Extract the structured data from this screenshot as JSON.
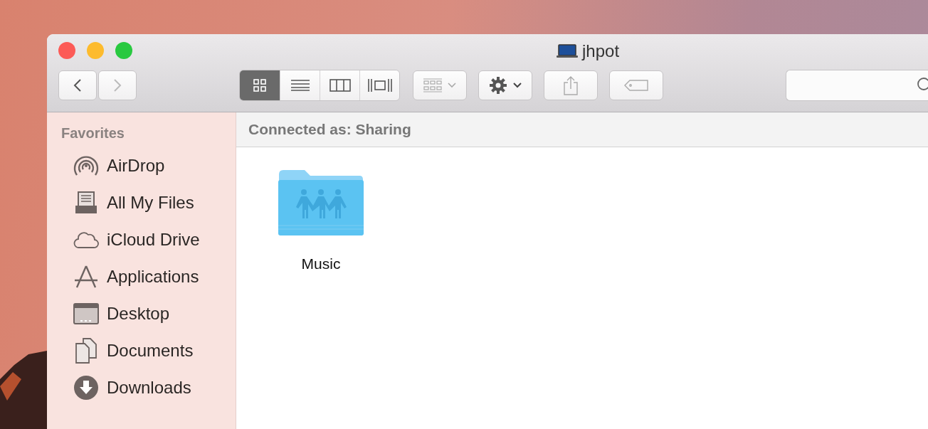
{
  "window": {
    "title": "jhpot"
  },
  "toolbar": {
    "view_modes": [
      {
        "kind": "icons",
        "selected": true
      },
      {
        "kind": "list",
        "selected": false
      },
      {
        "kind": "columns",
        "selected": false
      },
      {
        "kind": "coverflow",
        "selected": false
      }
    ]
  },
  "sidebar": {
    "heading": "Favorites",
    "items": [
      {
        "label": "AirDrop",
        "kind": "airdrop"
      },
      {
        "label": "All My Files",
        "kind": "files"
      },
      {
        "label": "iCloud Drive",
        "kind": "cloud"
      },
      {
        "label": "Applications",
        "kind": "apps"
      },
      {
        "label": "Desktop",
        "kind": "desktop"
      },
      {
        "label": "Documents",
        "kind": "documents"
      },
      {
        "label": "Downloads",
        "kind": "downloads"
      }
    ]
  },
  "header": {
    "text": "Connected as: Sharing"
  },
  "files": [
    {
      "name": "Music",
      "kind": "shared-folder"
    }
  ]
}
